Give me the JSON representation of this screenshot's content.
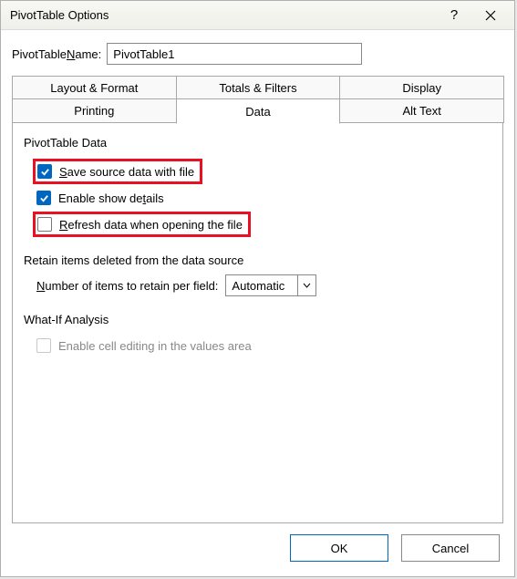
{
  "title": "PivotTable Options",
  "name_label_pre": "PivotTable ",
  "name_label_u": "N",
  "name_label_post": "ame:",
  "name_value": "PivotTable1",
  "tabs_row1": [
    "Layout & Format",
    "Totals & Filters",
    "Display"
  ],
  "tabs_row2": [
    "Printing",
    "Data",
    "Alt Text"
  ],
  "section_data": "PivotTable Data",
  "chk_save_pre": "",
  "chk_save_u": "S",
  "chk_save_post": "ave source data with file",
  "chk_show_pre": "Enable show de",
  "chk_show_u": "t",
  "chk_show_post": "ails",
  "chk_refresh_pre": "",
  "chk_refresh_u": "R",
  "chk_refresh_post": "efresh data when opening the file",
  "retain_title": "Retain items deleted from the data source",
  "retain_label_pre": "",
  "retain_label_u": "N",
  "retain_label_post": "umber of items to retain per field:",
  "retain_value": "Automatic",
  "whatif_title": "What-If Analysis",
  "chk_enable_cell": "Enable cell editing in the values area",
  "ok": "OK",
  "cancel": "Cancel"
}
